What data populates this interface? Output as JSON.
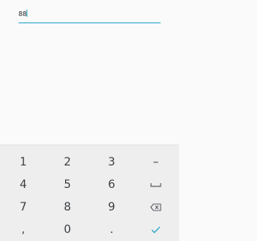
{
  "input": {
    "value": "88"
  },
  "keyboard": {
    "rows": [
      [
        {
          "label": "1"
        },
        {
          "label": "2"
        },
        {
          "label": "3"
        },
        {
          "label": "–"
        }
      ],
      [
        {
          "label": "4"
        },
        {
          "label": "5"
        },
        {
          "label": "6"
        },
        {
          "icon": "space-icon"
        }
      ],
      [
        {
          "label": "7"
        },
        {
          "label": "8"
        },
        {
          "label": "9"
        },
        {
          "icon": "backspace-icon"
        }
      ],
      [
        {
          "label": ","
        },
        {
          "label": "0"
        },
        {
          "label": "."
        },
        {
          "icon": "checkmark-icon"
        }
      ]
    ],
    "accent_color": "#26a5c9"
  }
}
